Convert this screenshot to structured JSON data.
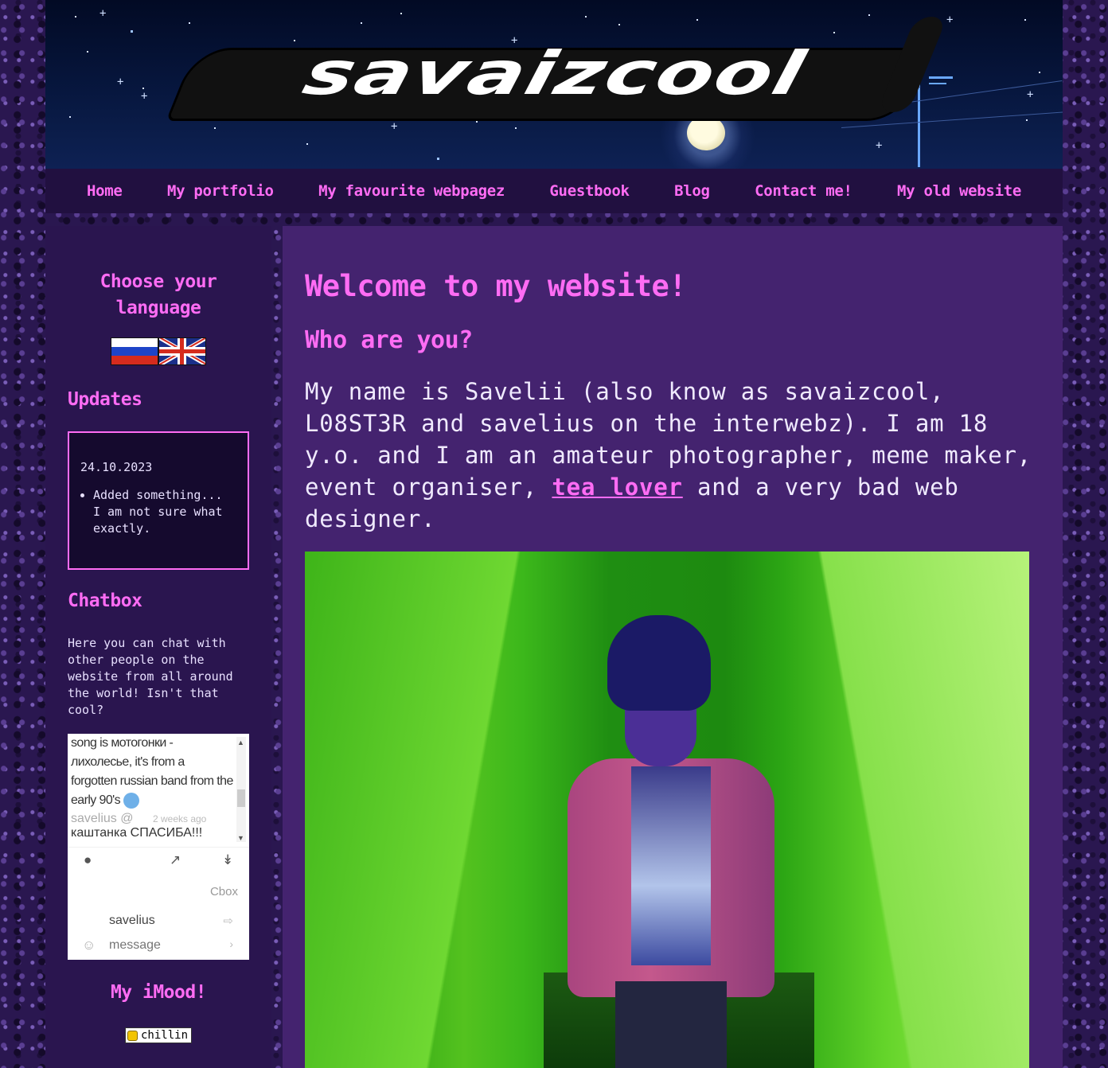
{
  "site": {
    "logo_text": "savaizcool"
  },
  "nav": {
    "items": [
      {
        "label": "Home"
      },
      {
        "label": "My portfolio"
      },
      {
        "label": "My favourite webpagez"
      },
      {
        "label": "Guestbook"
      },
      {
        "label": "Blog"
      },
      {
        "label": "Contact me!"
      },
      {
        "label": "My old website"
      }
    ]
  },
  "sidebar": {
    "language": {
      "title": "Choose your language",
      "flags": [
        {
          "icon": "flag-russia-icon"
        },
        {
          "icon": "flag-uk-icon"
        }
      ]
    },
    "updates": {
      "title": "Updates",
      "date": "24.10.2023",
      "items": [
        "Added something... I am not sure what exactly."
      ]
    },
    "chatbox": {
      "title": "Chatbox",
      "description": "Here you can chat with other people on the website from all around the world! Isn't that cool?",
      "messages": {
        "text": "song is мотогонки - лихолесье, it's from a forgotten russian band from the early 90's",
        "author": "savelius",
        "at": "@",
        "ago": "2 weeks ago",
        "next_text": "каштанка СПАСИБА!!!"
      },
      "brand": "Cbox",
      "username": "savelius",
      "message_placeholder": "message"
    },
    "imood": {
      "title": "My iMood!",
      "status": "chillin"
    }
  },
  "main": {
    "heading": "Welcome to my website!",
    "subheading": "Who are you?",
    "intro_before": "My name is Savelii (also know as savaizcool, L08ST3R and savelius on the interwebz). I am 18 y.o. and I am an amateur photographer, meme maker, event organiser, ",
    "intro_link": "tea lover",
    "intro_after": " and a very bad web designer."
  },
  "colors": {
    "accent": "#ff6cf4",
    "sidebar_bg": "#2a154f",
    "main_bg": "#44236f",
    "nav_bg": "#211040"
  }
}
